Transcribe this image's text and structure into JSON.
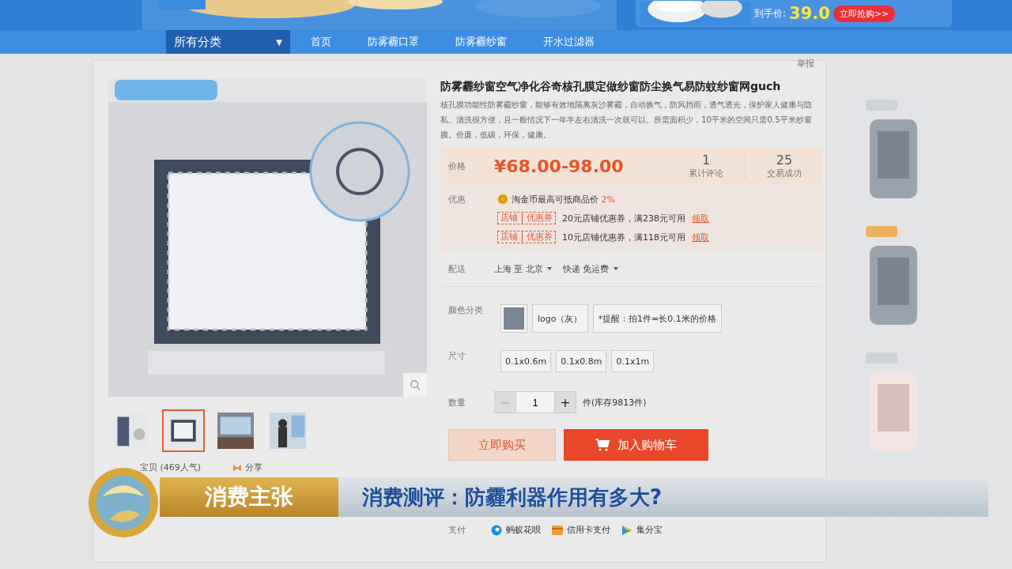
{
  "ad_banner": {
    "price_label": "到手价:",
    "price": "39.0",
    "button": "立即抢购>>"
  },
  "nav": [
    {
      "kind": "dropdown",
      "label": "所有分类",
      "caret": "▼"
    },
    {
      "kind": "link",
      "label": "首页"
    },
    {
      "kind": "link",
      "label": "防雾霾口罩"
    },
    {
      "kind": "link",
      "label": "防雾霾纱窗"
    },
    {
      "kind": "link",
      "label": "开水过滤器"
    }
  ],
  "report_link": "举报",
  "gallery": {
    "thumbnails": [
      {
        "selected": false
      },
      {
        "selected": true
      },
      {
        "selected": false
      },
      {
        "selected": false
      }
    ],
    "favorites": "宝贝 (469人气)",
    "share": "分享"
  },
  "product": {
    "title": "防雾霾纱窗空气净化谷奇核孔膜定做纱窗防尘换气易防蚊纱窗网guch",
    "description": "核孔膜功能性防雾霾纱窗，能够有效地隔离灰沙雾霾，自动换气，防风挡雨，透气透光，保护家人健康与隐私。清洗很方便，且一般情况下一年半左右清洗一次就可以。所需面积少，10平米的空间只需0.5平米纱窗膜。价廉，低碳，环保，健康。",
    "price": {
      "label": "价格",
      "value": "¥68.00-98.00"
    },
    "stats": [
      {
        "value": "1",
        "label": "累计评论"
      },
      {
        "value": "25",
        "label": "交易成功"
      }
    ],
    "promo": {
      "label": "优惠",
      "coin_text": "淘金币最高可抵商品价",
      "coin_rate": "2%",
      "coupons": [
        {
          "tag_1": "店铺",
          "tag_2": "优惠券",
          "text": "20元店铺优惠券，满238元可用",
          "action": "领取"
        },
        {
          "tag_1": "店铺",
          "tag_2": "优惠券",
          "text": "10元店铺优惠券，满118元可用",
          "action": "领取"
        }
      ]
    },
    "delivery": {
      "label": "配送",
      "from": "上海",
      "to_word": "至",
      "to": "北京",
      "shipping": "快递 免运费"
    },
    "color": {
      "label": "颜色分类",
      "options": [
        {
          "kind": "swatch",
          "selected": false
        },
        {
          "kind": "text",
          "label": "logo（灰）",
          "selected": false
        },
        {
          "kind": "text",
          "label": "*提醒：拍1件=长0.1米的价格",
          "selected": false
        }
      ]
    },
    "size": {
      "label": "尺寸",
      "options": [
        {
          "label": "0.1x0.6m",
          "selected": false
        },
        {
          "label": "0.1x0.8m",
          "selected": false
        },
        {
          "label": "0.1x1m",
          "selected": false
        }
      ]
    },
    "quantity": {
      "label": "数量",
      "decrement": "−",
      "decrement_disabled": true,
      "value": "1",
      "increment": "+",
      "stock": "件(库存9813件)"
    },
    "buy_now": "立即购买",
    "add_to_cart": "加入购物车",
    "payment": {
      "label": "支付",
      "methods": [
        {
          "kind": "huabei",
          "label": "蚂蚁花呗"
        },
        {
          "kind": "card",
          "label": "信用卡支付"
        },
        {
          "kind": "jifen",
          "label": "集分宝"
        }
      ]
    }
  },
  "tv_banner": {
    "show": "消费主张",
    "headline": "消费测评：防霾利器作用有多大?"
  }
}
